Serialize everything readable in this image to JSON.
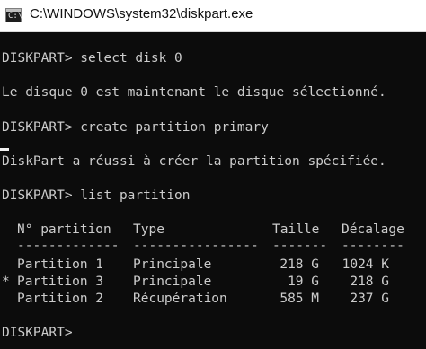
{
  "window": {
    "title": "C:\\WINDOWS\\system32\\diskpart.exe",
    "icon": "cmd-icon"
  },
  "console": {
    "lines": [
      "DISKPART> select disk 0",
      "Le disque 0 est maintenant le disque sélectionné.",
      "DISKPART> create partition primary",
      "DiskPart a réussi à créer la partition spécifiée.",
      "DISKPART> list partition"
    ],
    "table": {
      "headers": [
        "N° partition",
        "Type",
        "Taille",
        "Décalage"
      ],
      "separators": [
        "-------------",
        "----------------",
        "-------",
        "--------"
      ],
      "rows": [
        {
          "marker": " ",
          "num": "Partition 1",
          "type": "Principale",
          "size": "218 G",
          "offset": "1024 K"
        },
        {
          "marker": "*",
          "num": "Partition 3",
          "type": "Principale",
          "size": "19 G",
          "offset": "218 G"
        },
        {
          "marker": " ",
          "num": "Partition 2",
          "type": "Récupération",
          "size": "585 M",
          "offset": "237 G"
        }
      ]
    },
    "final_prompt": "DISKPART>"
  }
}
